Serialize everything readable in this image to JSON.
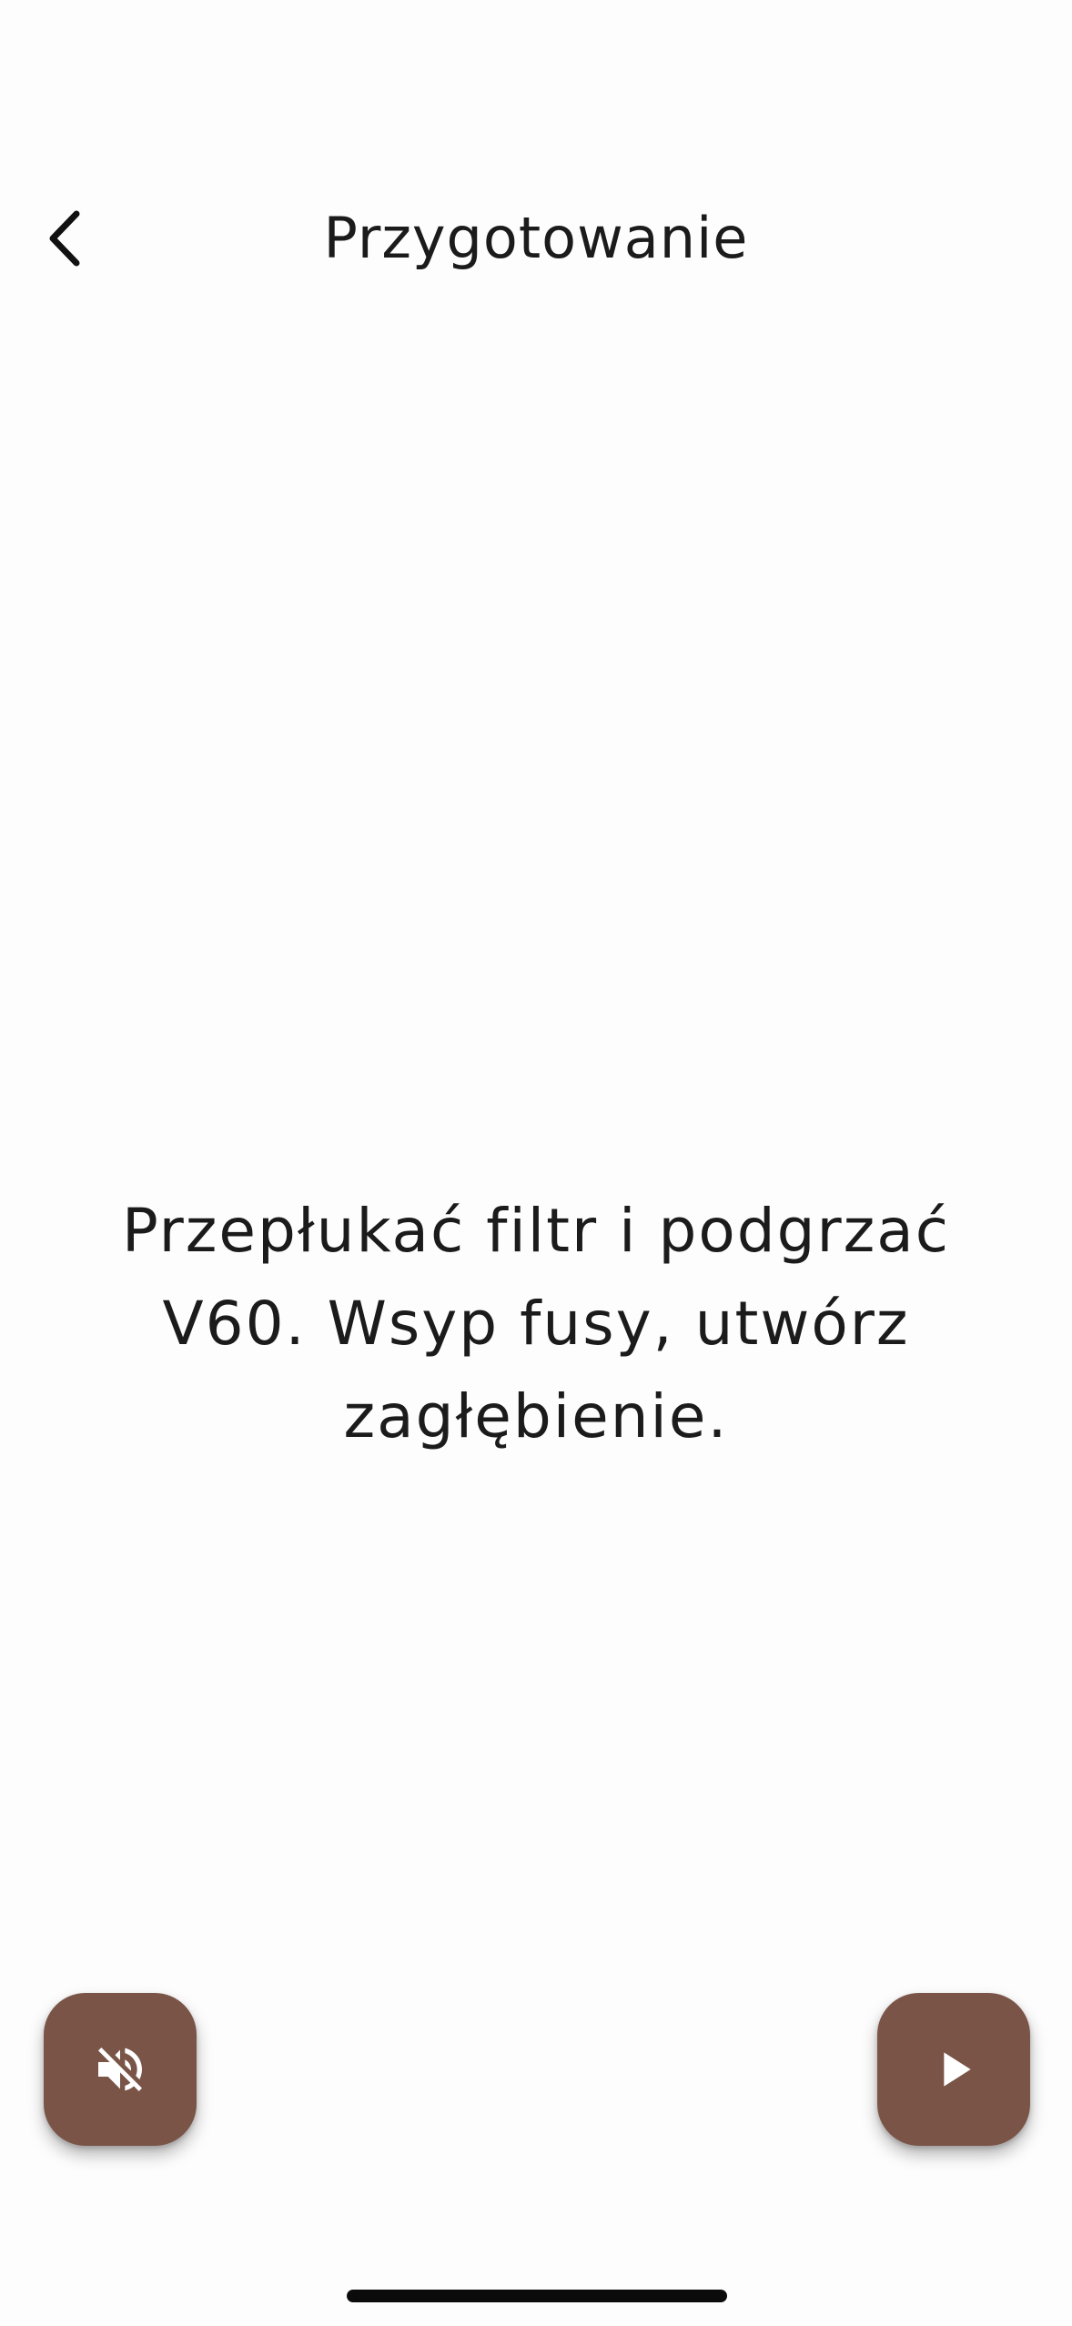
{
  "header": {
    "title": "Przygotowanie",
    "back_icon": "chevron-left-icon"
  },
  "step": {
    "instruction": "Przepłukać filtr i podgrzać V60. Wsyp fusy, utwórz zagłębienie."
  },
  "controls": {
    "mute_icon": "volume-off-icon",
    "play_icon": "play-icon"
  },
  "colors": {
    "accent": "#7a5447",
    "background": "#fefdfd",
    "text": "#1c1b1b",
    "icon_on_accent": "#ffffff"
  }
}
